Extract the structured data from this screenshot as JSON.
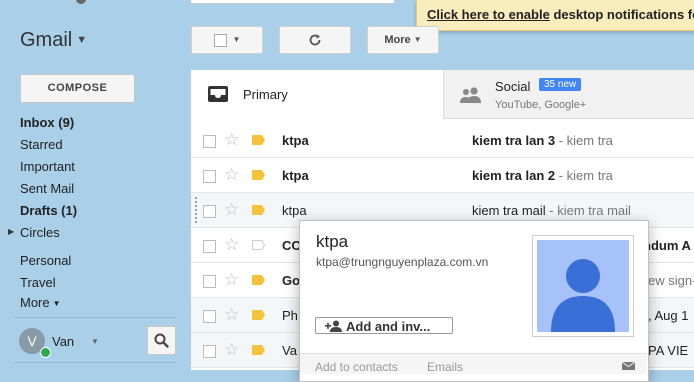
{
  "app": {
    "title": "Gmail"
  },
  "notification": {
    "link_text": "Click here to enable",
    "rest_text": " desktop notifications fo"
  },
  "toolbar": {
    "more_label": "More"
  },
  "sidebar": {
    "compose_label": "COMPOSE",
    "items": [
      {
        "label": "Inbox (9)",
        "bold": true
      },
      {
        "label": "Starred",
        "bold": false
      },
      {
        "label": "Important",
        "bold": false
      },
      {
        "label": "Sent Mail",
        "bold": false
      },
      {
        "label": "Drafts (1)",
        "bold": true
      },
      {
        "label": "Circles",
        "bold": false
      },
      {
        "label": "Personal",
        "bold": false
      },
      {
        "label": "Travel",
        "bold": false
      },
      {
        "label": "More",
        "bold": false
      }
    ],
    "user": {
      "initial": "V",
      "name": "Van"
    }
  },
  "tabs": {
    "primary_label": "Primary",
    "social_label": "Social",
    "social_badge": "35 new",
    "social_sub": "YouTube, Google+"
  },
  "emails": [
    {
      "sender": "ktpa",
      "subject": "kiem tra lan 3",
      "snippet": " - kiem tra",
      "unread": true
    },
    {
      "sender": "ktpa",
      "subject": "kiem tra lan 2",
      "snippet": " - kiem tra",
      "unread": true
    },
    {
      "sender": "ktpa",
      "subject": "kiem tra mail",
      "snippet": " - kiem tra mail",
      "unread": false
    },
    {
      "sender": "CO",
      "subject": "ndum A",
      "snippet": "",
      "unread": true
    },
    {
      "sender": "Go",
      "subject": "ew sign-",
      "snippet": "",
      "unread": true
    },
    {
      "sender": "Ph",
      "subject": ", Aug 1",
      "snippet": "",
      "unread": false
    },
    {
      "sender": "Va",
      "subject": "PA VIE",
      "snippet": "",
      "unread": false
    }
  ],
  "hovercard": {
    "name": "ktpa",
    "email": "ktpa@trungnguyenplaza.com.vn",
    "add_button": "Add and inv...",
    "footer_add": "Add to contacts",
    "footer_emails": "Emails"
  }
}
